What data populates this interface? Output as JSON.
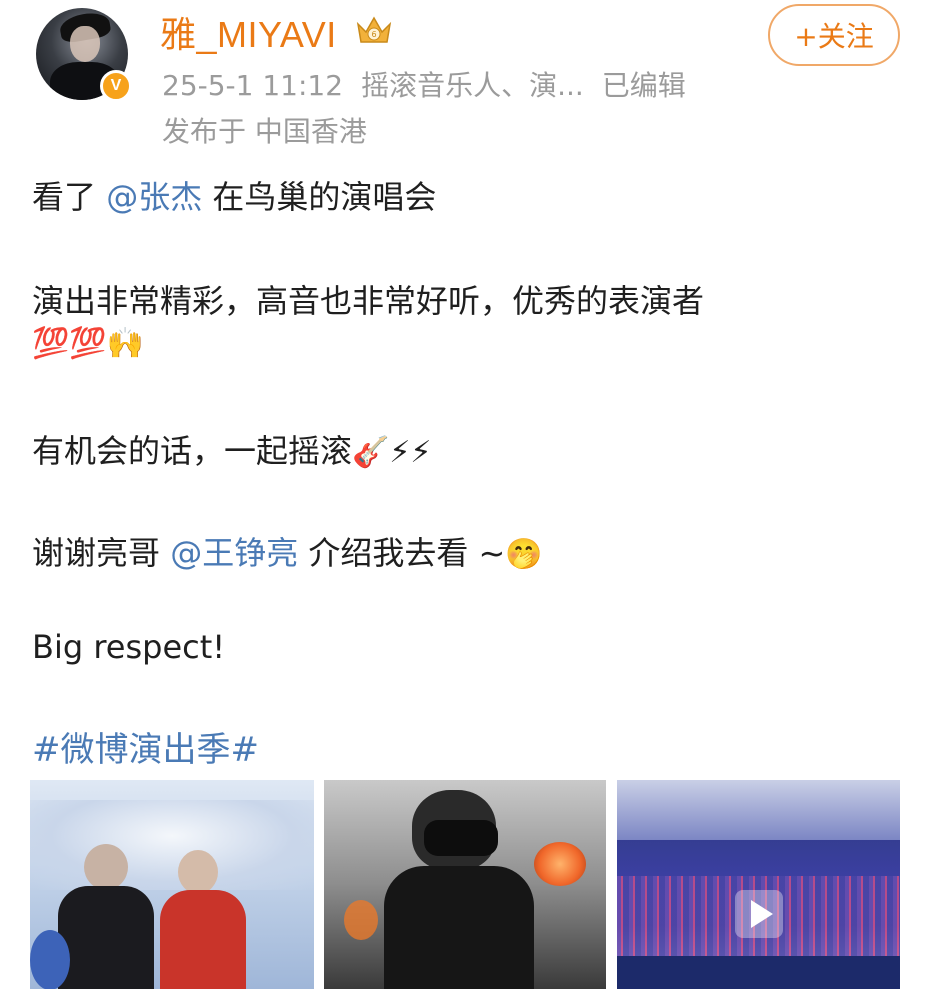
{
  "header": {
    "username": "雅_MIYAVI",
    "timestamp": "25-5-1 11:12",
    "description": "摇滚音乐人、演...",
    "edited_label": "已编辑",
    "location": "发布于 中国香港",
    "follow_label": "+关注"
  },
  "post": {
    "line1_prefix": "看了 ",
    "line1_mention": "@张杰",
    "line1_suffix": " 在鸟巢的演唱会",
    "line2": "演出非常精彩，高音也非常好听，优秀的表演者",
    "line2_emojis": "💯💯🙌",
    "line3": "有机会的话，一起摇滚",
    "line3_emojis": "🎸⚡⚡",
    "line4_prefix": "谢谢亮哥 ",
    "line4_mention": "@王铮亮",
    "line4_suffix": " 介绍我去看 ~",
    "line4_emoji": "🤭",
    "line5": "Big respect!",
    "hashtag": "#微博演出季#"
  },
  "colors": {
    "username": "#ea7a16",
    "mention": "#4a7ab5",
    "meta": "#9b9b9b",
    "follow_border": "#f0a868"
  },
  "icons": {
    "verified": "v-badge-icon",
    "member": "crown-icon",
    "video": "play-icon"
  }
}
